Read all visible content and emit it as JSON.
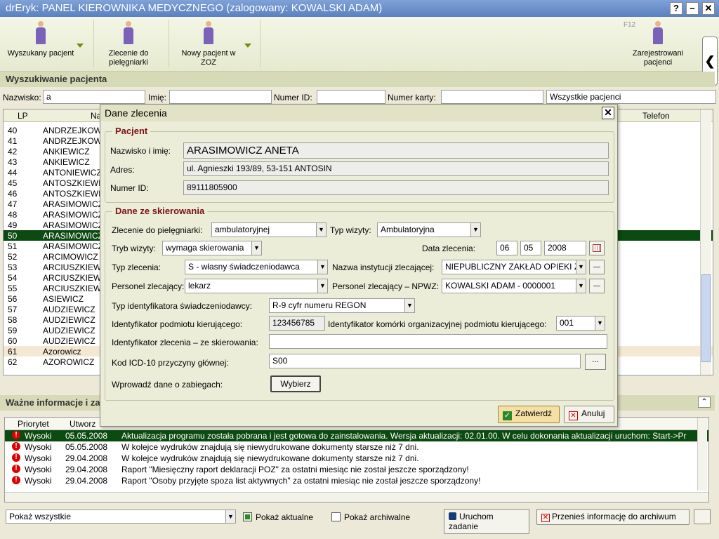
{
  "window": {
    "title": "drEryk: PANEL KIEROWNIKA MEDYCZNEGO (zalogowany: KOWALSKI ADAM)",
    "help": "?",
    "minimize": "–",
    "close": "✕"
  },
  "toolbar": {
    "found_patient": "Wyszukany pacjent",
    "order_nurse": "Zlecenie do pielęgniarki",
    "new_patient": "Nowy pacjent w ZOZ",
    "registered_patients": "Zarejestrowani pacjenci",
    "f12": "F12",
    "collapse": "❮"
  },
  "search": {
    "section_title": "Wyszukiwanie pacjenta",
    "surname_label": "Nazwisko:",
    "surname_value": "a",
    "name_label": "Imię:",
    "name_value": "",
    "id_label": "Numer ID:",
    "id_value": "",
    "card_label": "Numer karty:",
    "card_value": "",
    "filter_value": "Wszystkie pacjenci"
  },
  "grid": {
    "col_lp": "LP",
    "col_name": "Na",
    "col_phone": "Telefon",
    "rows": [
      [
        "40",
        "ANDRZEJKOWI"
      ],
      [
        "41",
        "ANDRZEJKOWI"
      ],
      [
        "42",
        "ANKIEWICZ"
      ],
      [
        "43",
        "ANKIEWICZ"
      ],
      [
        "44",
        "ANTONIEWICZ"
      ],
      [
        "45",
        "ANTOSZKIEWI"
      ],
      [
        "46",
        "ANTOSZKIEWI"
      ],
      [
        "47",
        "ARASIMOWICZ"
      ],
      [
        "48",
        "ARASIMOWICZ"
      ],
      [
        "49",
        "ARASIMOWICZ"
      ],
      [
        "50",
        "ARASIMOWICZ"
      ],
      [
        "51",
        "ARASIMOWICZ"
      ],
      [
        "52",
        "ARCIMOWICZ"
      ],
      [
        "53",
        "ARCIUSZKIEWI"
      ],
      [
        "54",
        "ARCIUSZKIEWI"
      ],
      [
        "55",
        "ARCIUSZKIEWI"
      ],
      [
        "56",
        "ASIEWICZ"
      ],
      [
        "57",
        "AUDZIEWICZ"
      ],
      [
        "58",
        "AUDZIEWICZ"
      ],
      [
        "59",
        "AUDZIEWICZ"
      ],
      [
        "60",
        "AUDZIEWICZ"
      ],
      [
        "61",
        "Azorowicz"
      ],
      [
        "62",
        "AZOROWICZ"
      ]
    ]
  },
  "info": {
    "section_title": "Ważne informacje i zad",
    "col_priority": "Priorytet",
    "col_created": "Utworz",
    "rows": [
      [
        "Wysoki",
        "05.05.2008",
        "Aktualizacja programu została pobrana i jest gotowa do zainstalowania. Wersja aktualizacji: 02.01.00. W celu dokonania aktualizacji uruchom: Start->Pr"
      ],
      [
        "Wysoki",
        "05.05.2008",
        "W kolejce wydruków znajdują się niewydrukowane dokumenty starsze niż 7 dni."
      ],
      [
        "Wysoki",
        "29.04.2008",
        "W kolejce wydruków znajdują się niewydrukowane dokumenty starsze niż 7 dni."
      ],
      [
        "Wysoki",
        "29.04.2008",
        "Raport \"Miesięczny raport deklaracji POZ\" za ostatni miesiąc nie został jeszcze sporządzony!"
      ],
      [
        "Wysoki",
        "29.04.2008",
        "Raport \"Osoby przyjęte spoza list aktywnych\" za ostatni miesiąc nie został jeszcze sporządzony!"
      ]
    ]
  },
  "bottom": {
    "show_filter": "Pokaż wszystkie",
    "show_current": "Pokaż aktualne",
    "show_archive": "Pokaż archiwalne",
    "run_task": "Uruchom zadanie",
    "move_archive": "Przenieś informację do archiwum"
  },
  "dialog": {
    "title": "Dane zlecenia",
    "patient_group": "Pacjent",
    "name_label": "Nazwisko i imię:",
    "name_value": "ARASIMOWICZ ANETA",
    "address_label": "Adres:",
    "address_value": "ul. Agnieszki 193/89, 53-151 ANTOSIN",
    "id_label": "Numer ID:",
    "id_value": "89111805900",
    "referral_group": "Dane ze skierowania",
    "order_nurse_label": "Zlecenie do pielęgniarki:",
    "order_nurse_value": "ambulatoryjnej",
    "visit_type_label": "Typ wizyty:",
    "visit_type_value": "Ambulatoryjna",
    "visit_mode_label": "Tryb wizyty:",
    "visit_mode_value": "wymaga skierowania",
    "order_date_label": "Data zlecenia:",
    "date_day": "06",
    "date_month": "05",
    "date_year": "2008",
    "order_type_label": "Typ zlecenia:",
    "order_type_value": "S - własny świadczeniodawca",
    "institution_label": "Nazwa instytucji zlecającej:",
    "institution_value": "NIEPUBLICZNY ZAKŁAD OPIEKI Z",
    "staff_label": "Personel zlecający:",
    "staff_value": "lekarz",
    "staff_npwz_label": "Personel zlecający – NPWZ:",
    "staff_npwz_value": "KOWALSKI ADAM - 0000001",
    "provider_id_type_label": "Typ identyfikatora świadczeniodawcy:",
    "provider_id_type_value": "R-9 cyfr numeru REGON",
    "referring_entity_label": "Identyfikator podmiotu kierującego:",
    "referring_entity_value": "123456785",
    "referring_unit_label": "Identyfikator komórki organizacyjnej podmiotu kierującego:",
    "referring_unit_value": "001",
    "referral_id_label": "Identyfikator zlecenia – ze skierowania:",
    "referral_id_value": "",
    "icd_label": "Kod ICD-10 przyczyny głównej:",
    "icd_value": "S00",
    "icd_button": "...",
    "procedures_label": "Wprowadź dane o zabiegach:",
    "procedures_button": "Wybierz",
    "confirm": "Zatwierdź",
    "cancel": "Anuluj"
  }
}
